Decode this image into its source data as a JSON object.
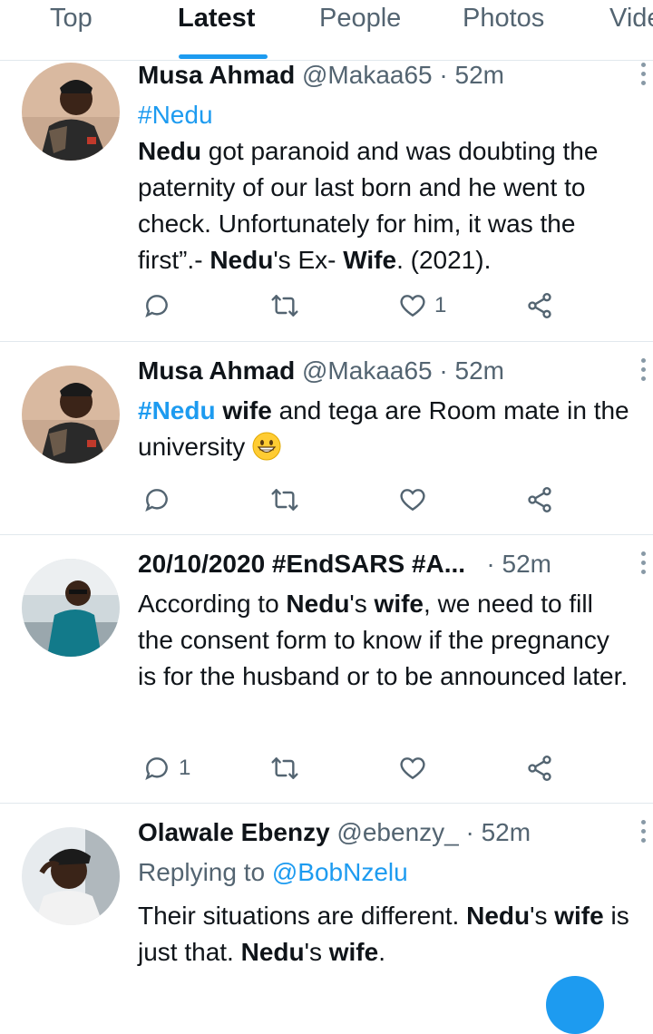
{
  "tabs": [
    "Top",
    "Latest",
    "People",
    "Photos",
    "Videos"
  ],
  "tweets": [
    {
      "name": "Musa Ahmad",
      "handle": "@Makaa65",
      "dot": "·",
      "time": "52m",
      "hashtag": "#Nedu",
      "body": {
        "p1": "Nedu",
        "p2": " got paranoid and was doubting the paternity of our last born and he went to check. Unfortunately for him, it was the first”.- ",
        "p3": "Nedu",
        "p4": "'s Ex- ",
        "p5": "Wife",
        "p6": ". (2021)."
      },
      "likes": "1"
    },
    {
      "name": "Musa Ahmad",
      "handle": "@Makaa65",
      "dot": "·",
      "time": "52m",
      "body": {
        "p1": "#Nedu",
        "p2": " ",
        "p3": "wife",
        "p4": " and tega are Room mate in the university "
      },
      "emoji": "grinning-face-emoji"
    },
    {
      "name": "20/10/2020 #EndSARS #A...",
      "dot": "·",
      "time": "52m",
      "body": {
        "p1": "According to ",
        "p2": "Nedu",
        "p3": "'s ",
        "p4": "wife",
        "p5": ", we need to fill the consent form to know if the pregnancy is for the husband or to be announced later."
      },
      "replies": "1"
    },
    {
      "name": "Olawale Ebenzy",
      "handle": "@ebenzy_",
      "dot": "·",
      "time": "52m",
      "replying_label": "Replying to ",
      "replying_to": "@BobNzelu",
      "body": {
        "p1": "Their situations are different. ",
        "p2": "Nedu",
        "p3": "'s ",
        "p4": "wife",
        "p5": " is just that. ",
        "p6": "Nedu",
        "p7": "'s ",
        "p8": "wife",
        "p9": "."
      }
    }
  ],
  "colors": {
    "accent": "#1d9bf0",
    "text": "#0f1419",
    "secondary": "#536471",
    "divider": "#e1e8ed"
  }
}
